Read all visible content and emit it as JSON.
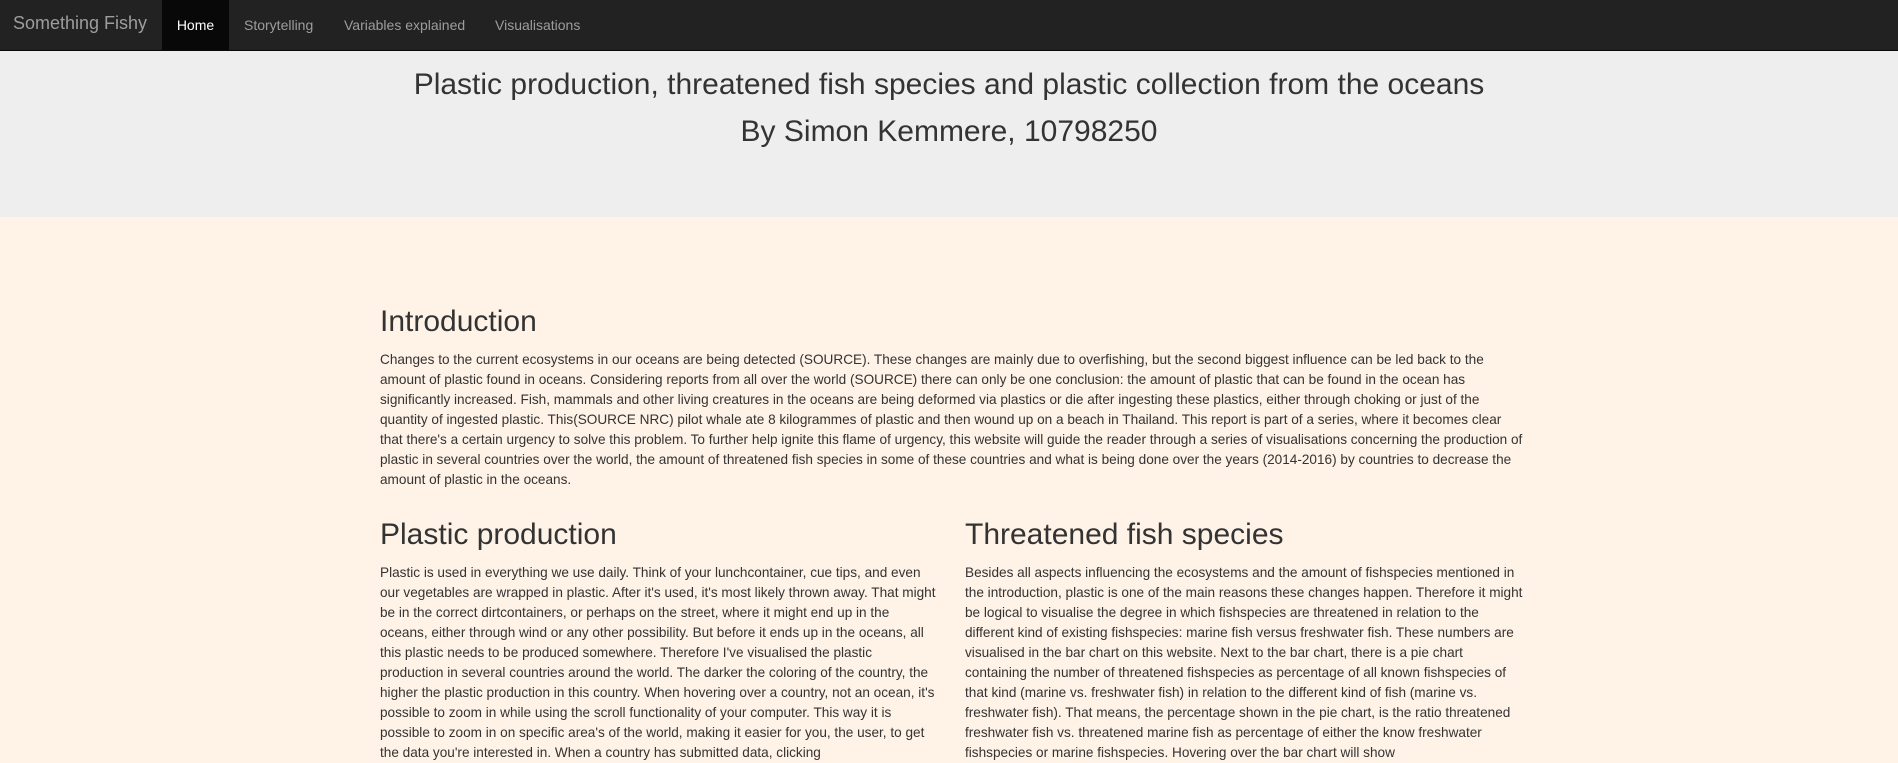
{
  "nav": {
    "brand": "Something Fishy",
    "items": [
      {
        "label": "Home",
        "active": true
      },
      {
        "label": "Storytelling",
        "active": false
      },
      {
        "label": "Variables explained",
        "active": false
      },
      {
        "label": "Visualisations",
        "active": false
      }
    ]
  },
  "header": {
    "title": "Plastic production, threatened fish species and plastic collection from the oceans",
    "subtitle": "By Simon Kemmere, 10798250"
  },
  "intro": {
    "title": "Introduction",
    "text": "Changes to the current ecosystems in our oceans are being detected (SOURCE). These changes are mainly due to overfishing, but the second biggest influence can be led back to the amount of plastic found in oceans. Considering reports from all over the world (SOURCE) there can only be one conclusion: the amount of plastic that can be found in the ocean has significantly increased. Fish, mammals and other living creatures in the oceans are being deformed via plastics or die after ingesting these plastics, either through choking or just of the quantity of ingested plastic. This(SOURCE NRC) pilot whale ate 8 kilogrammes of plastic and then wound up on a beach in Thailand. This report is part of a series, where it becomes clear that there's a certain urgency to solve this problem. To further help ignite this flame of urgency, this website will guide the reader through a series of visualisations concerning the production of plastic in several countries over the world, the amount of threatened fish species in some of these countries and what is being done over the years (2014-2016) by countries to decrease the amount of plastic in the oceans."
  },
  "plastic": {
    "title": "Plastic production",
    "text": "Plastic is used in everything we use daily. Think of your lunchcontainer, cue tips, and even our vegetables are wrapped in plastic. After it's used, it's most likely thrown away. That might be in the correct dirtcontainers, or perhaps on the street, where it might end up in the oceans, either through wind or any other possibility. But before it ends up in the oceans, all this plastic needs to be produced somewhere. Therefore I've visualised the plastic production in several countries around the world. The darker the coloring of the country, the higher the plastic production in this country. When hovering over a country, not an ocean, it's possible to zoom in while using the scroll functionality of your computer. This way it is possible to zoom in on specific area's of the world, making it easier for you, the user, to get the data you're interested in. When a country has submitted data, clicking"
  },
  "fish": {
    "title": "Threatened fish species",
    "text": "Besides all aspects influencing the ecosystems and the amount of fishspecies mentioned in the introduction, plastic is one of the main reasons these changes happen. Therefore it might be logical to visualise the degree in which fishspecies are threatened in relation to the different kind of existing fishspecies: marine fish versus freshwater fish. These numbers are visualised in the bar chart on this website. Next to the bar chart, there is a pie chart containing the number of threatened fishspecies as percentage of all known fishspecies of that kind (marine vs. freshwater fish) in relation to the different kind of fish (marine vs. freshwater fish). That means, the percentage shown in the pie chart, is the ratio threatened freshwater fish vs. threatened marine fish as percentage of either the know freshwater fishspecies or marine fishspecies. Hovering over the bar chart will show"
  }
}
